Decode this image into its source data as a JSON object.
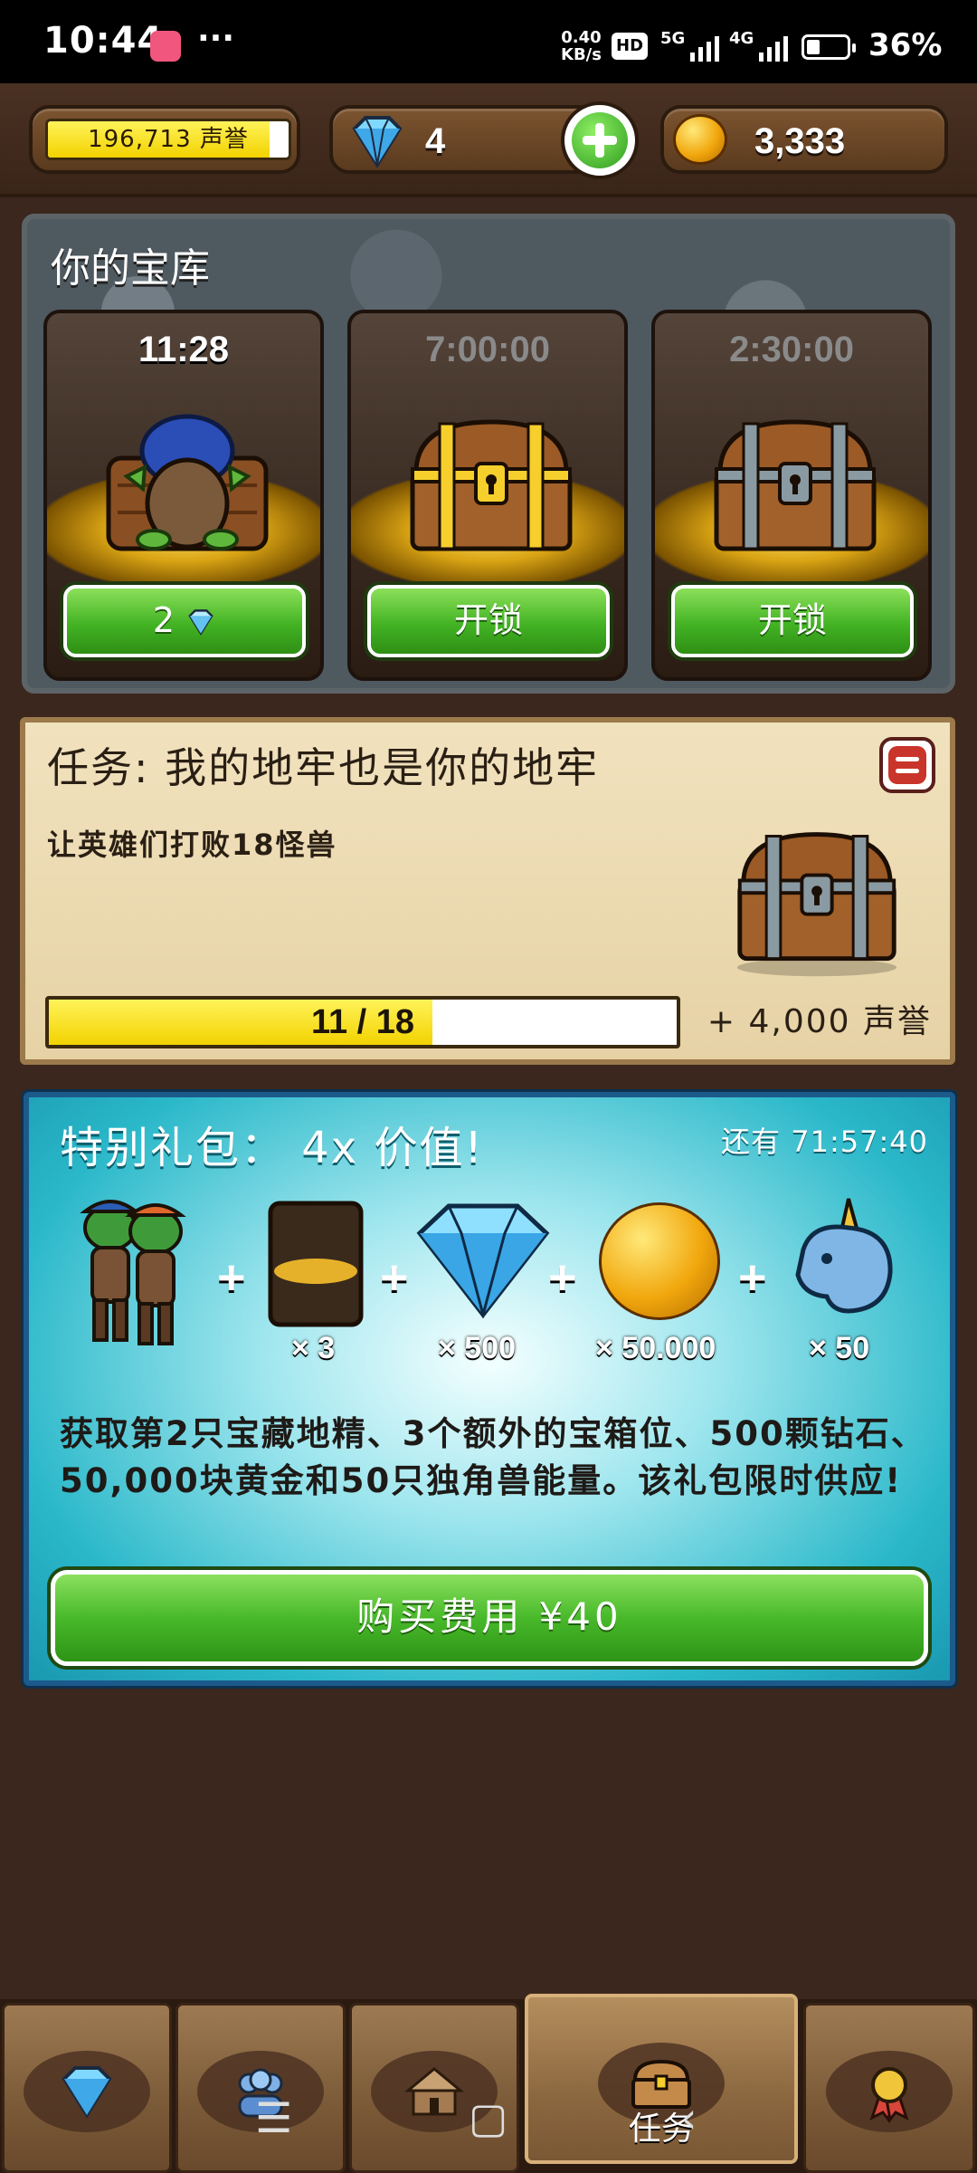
{
  "status_bar": {
    "time": "10:44",
    "more": "···",
    "speed_value": "0.40",
    "speed_unit": "KB/s",
    "hd": "HD",
    "net1": "5G",
    "net2": "4G",
    "battery_level": 0.36,
    "battery": "36%"
  },
  "currency": {
    "reputation": "196,713 声誉",
    "reputation_fill": 0.92,
    "gems": "4",
    "gold": "3,333"
  },
  "vault": {
    "title": "你的宝库",
    "slots": [
      {
        "timer": "11:28",
        "button": "2"
      },
      {
        "timer": "7:00:00",
        "button": "开锁"
      },
      {
        "timer": "2:30:00",
        "button": "开锁"
      }
    ]
  },
  "quest": {
    "title": "任务: 我的地牢也是你的地牢",
    "description": "让英雄们打败18怪兽",
    "progress_text": "11 / 18",
    "progress": 0.611,
    "reward": "+ 4,000 声誉"
  },
  "offer": {
    "title": "特别礼包： 4x 价值!",
    "timer": "还有 71:57:40",
    "items": [
      {
        "qty": ""
      },
      {
        "qty": "× 3"
      },
      {
        "qty": "× 500"
      },
      {
        "qty": "× 50.000"
      },
      {
        "qty": "× 50"
      }
    ],
    "plus": "+",
    "description": "获取第2只宝藏地精、3个额外的宝箱位、500颗钻石、50,000块黄金和50只独角兽能量。该礼包限时供应!",
    "buy_label": "购买费用 ¥40"
  },
  "tabs": [
    {
      "icon": "gem-icon",
      "label": ""
    },
    {
      "icon": "heroes-icon",
      "label": ""
    },
    {
      "icon": "dungeon-icon",
      "label": ""
    },
    {
      "icon": "chest-icon",
      "label": "任务",
      "active": true
    },
    {
      "icon": "medal-icon",
      "label": ""
    }
  ],
  "colors": {
    "accent_green": "#43b324",
    "progress_yellow": "#f2d200",
    "wood_brown": "#7b5a38",
    "offer_teal": "#2ab8c9"
  }
}
